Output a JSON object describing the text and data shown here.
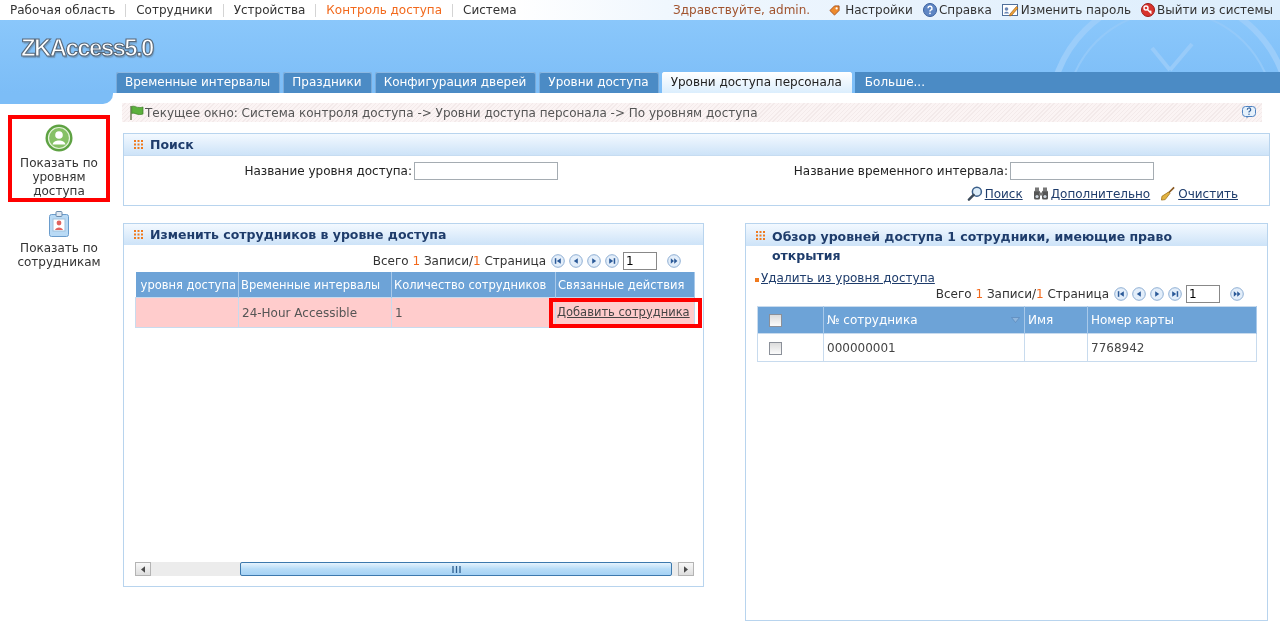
{
  "top_menu": [
    {
      "label": "Рабочая область",
      "selected": false
    },
    {
      "label": "Сотрудники",
      "selected": false
    },
    {
      "label": "Устройства",
      "selected": false
    },
    {
      "label": "Контроль доступа",
      "selected": true
    },
    {
      "label": "Система",
      "selected": false
    }
  ],
  "user_bar": {
    "greeting": "Здравствуйте, admin.",
    "links": [
      {
        "kind": "settings",
        "label": "Настройки"
      },
      {
        "kind": "help",
        "label": "Справка"
      },
      {
        "kind": "password",
        "label": "Изменить пароль"
      },
      {
        "kind": "logout",
        "label": "Выйти из системы"
      }
    ]
  },
  "logo": "ZKAccess5.0",
  "tabs": [
    {
      "kind": "tab",
      "label": "Временные интервалы",
      "selected": false
    },
    {
      "kind": "tab",
      "label": "Праздники",
      "selected": false
    },
    {
      "kind": "tab",
      "label": "Конфигурация дверей",
      "selected": false
    },
    {
      "kind": "tab",
      "label": "Уровни доступа",
      "selected": false
    },
    {
      "kind": "tab",
      "label": "Уровни доступа персонала",
      "selected": true
    },
    {
      "kind": "more",
      "label": "Больше...",
      "selected": false
    }
  ],
  "sidebar": {
    "items": [
      {
        "kind": "levels",
        "label": "Показать по уровням доступа",
        "highlighted": true
      },
      {
        "kind": "employees",
        "label": "Показать по сотрудникам",
        "highlighted": false
      }
    ]
  },
  "breadcrumb": "Текущее окно: Система контроля доступа -> Уровни доступа персонала -> По уровням доступа",
  "search": {
    "title": "Поиск",
    "fields": [
      {
        "label": "Название уровня доступа:"
      },
      {
        "label": "Название временного интервала:"
      }
    ],
    "actions": [
      {
        "kind": "search",
        "label": "Поиск"
      },
      {
        "kind": "advanced",
        "label": "Дополнительно"
      },
      {
        "kind": "clear",
        "label": "Очистить"
      }
    ]
  },
  "levels_panel": {
    "title": "Изменить сотрудников в уровне доступа",
    "pager": {
      "prefix": "Всего",
      "records": "1",
      "records_suffix": "Записи/",
      "pages": "1",
      "pages_suffix": "Страница",
      "page": "1"
    },
    "columns": [
      "уровня доступа",
      "Временные интервалы",
      "Количество сотрудников",
      "Связанные действия"
    ],
    "rows": [
      {
        "selected": true,
        "time_intervals": "24-Hour Accessible",
        "employee_count": "1",
        "action": {
          "label": "Добавить сотрудника",
          "highlighted": true
        }
      }
    ]
  },
  "employees_panel": {
    "title": "Обзор уровней доступа 1 сотрудники, имеющие право открытия",
    "delete_link": "Удалить из уровня доступа",
    "pager": {
      "prefix": "Всего",
      "records": "1",
      "records_suffix": "Записи/",
      "pages": "1",
      "pages_suffix": "Страница",
      "page": "1"
    },
    "select_all": {
      "checked": false
    },
    "columns": [
      {
        "label": "№ сотрудника",
        "sorted": true
      },
      {
        "label": "Имя",
        "sorted": false
      },
      {
        "label": "Номер карты",
        "sorted": false
      }
    ],
    "rows": [
      {
        "checked": false,
        "employee_no": "000000001",
        "card_no": "7768942"
      }
    ]
  }
}
